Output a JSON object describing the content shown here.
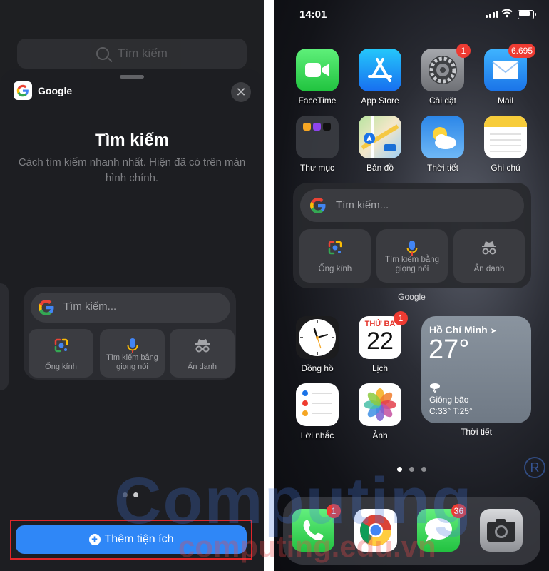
{
  "left": {
    "background_search": "Tìm kiếm",
    "sheet": {
      "app_name": "Google",
      "close_label": "✕",
      "title": "Tìm kiếm",
      "description": "Cách tìm kiếm nhanh nhất. Hiện đã có trên màn hình chính."
    },
    "preview_widget": {
      "search_placeholder": "Tìm kiếm...",
      "buttons": [
        {
          "label": "Ống kính",
          "icon": "lens-icon"
        },
        {
          "label": "Tìm kiếm bằng giọng nói",
          "icon": "microphone-icon"
        },
        {
          "label": "Ẩn danh",
          "icon": "incognito-icon"
        }
      ]
    },
    "page_dots": {
      "count": 2,
      "active": 1
    },
    "add_button_label": "Thêm tiện ích"
  },
  "right": {
    "status_bar": {
      "time": "14:01"
    },
    "apps_row1": [
      {
        "label": "FaceTime",
        "icon": "facetime-icon"
      },
      {
        "label": "App Store",
        "icon": "app-store-icon"
      },
      {
        "label": "Cài đặt",
        "icon": "settings-icon",
        "badge": "1"
      },
      {
        "label": "Mail",
        "icon": "mail-icon",
        "badge": "6.695"
      }
    ],
    "apps_row2": [
      {
        "label": "Thư mục",
        "icon": "folder-icon"
      },
      {
        "label": "Bản đồ",
        "icon": "maps-icon"
      },
      {
        "label": "Thời tiết",
        "icon": "weather-icon"
      },
      {
        "label": "Ghi chú",
        "icon": "notes-icon"
      }
    ],
    "google_widget": {
      "search_placeholder": "Tìm kiếm...",
      "buttons": [
        {
          "label": "Ống kính",
          "icon": "lens-icon"
        },
        {
          "label": "Tìm kiếm bằng giọng nói",
          "icon": "microphone-icon"
        },
        {
          "label": "Ẩn danh",
          "icon": "incognito-icon"
        }
      ],
      "label": "Google"
    },
    "clock": {
      "label": "Đồng hồ"
    },
    "calendar": {
      "weekday": "THỨ BA",
      "day": "22",
      "label": "Lịch",
      "badge": "1"
    },
    "reminders": {
      "label": "Lời nhắc"
    },
    "photos": {
      "label": "Ảnh"
    },
    "weather_widget": {
      "city": "Hồ Chí Minh",
      "temp": "27°",
      "condition": "Giông bão",
      "range": "C:33° T:25°",
      "label": "Thời tiết"
    },
    "page_dots": {
      "count": 3,
      "active": 0
    },
    "dock": [
      {
        "icon": "phone-icon",
        "badge": "1"
      },
      {
        "icon": "chrome-icon"
      },
      {
        "icon": "messages-icon",
        "badge": "36"
      },
      {
        "icon": "camera-icon"
      }
    ]
  },
  "watermark": {
    "brand": "Computing",
    "domain": "computing.edu.vn",
    "mark": "R"
  },
  "colors": {
    "accent_blue": "#2f87f7",
    "badge_red": "#ee3b32",
    "highlight_border": "#e1262a"
  }
}
